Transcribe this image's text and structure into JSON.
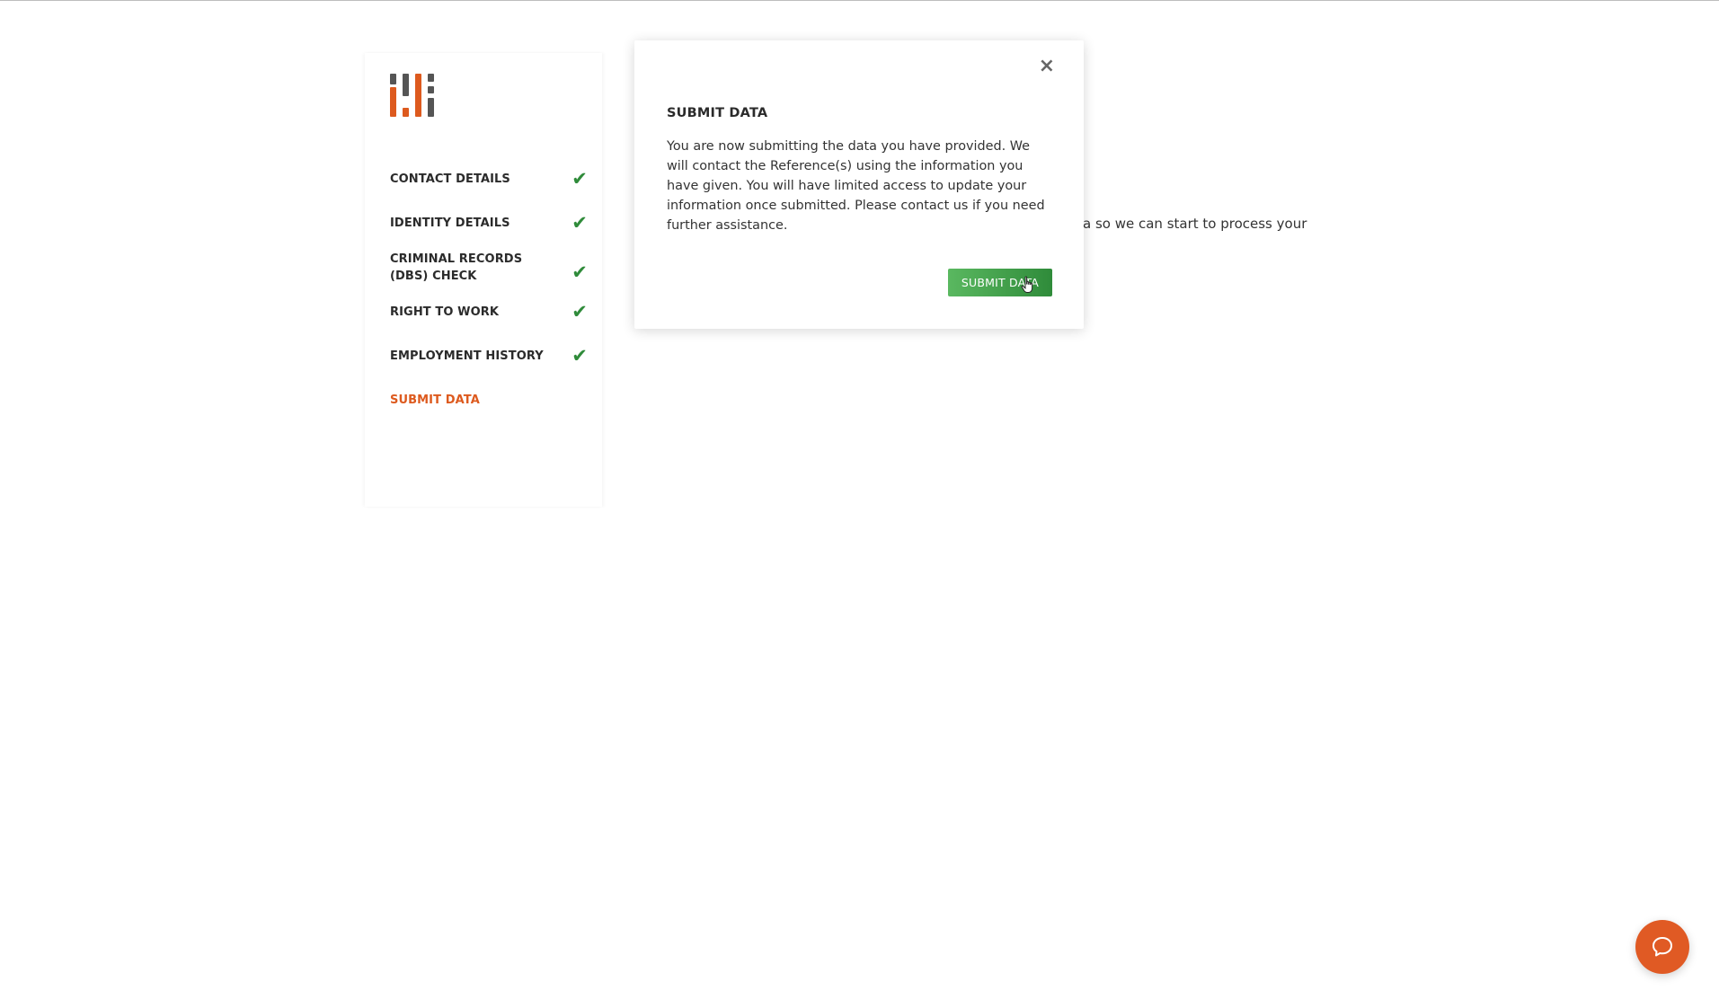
{
  "sidebar": {
    "logo": {
      "icon": "bars-logo-icon",
      "colors": {
        "orange": "#dd5a1e",
        "grey": "#555555"
      }
    },
    "items": [
      {
        "label": "CONTACT DETAILS",
        "done": true
      },
      {
        "label": "IDENTITY DETAILS",
        "done": true
      },
      {
        "label": "CRIMINAL RECORDS (DBS) CHECK",
        "done": true
      },
      {
        "label": "RIGHT TO WORK",
        "done": true
      },
      {
        "label": "EMPLOYMENT HISTORY",
        "done": true
      },
      {
        "label": "SUBMIT DATA",
        "done": false,
        "active": true
      }
    ],
    "check_glyph": "✔",
    "active_color": "#dd5a1e",
    "check_color": "#2f8b3a"
  },
  "background": {
    "partial_text": "a so we can start to process your"
  },
  "modal": {
    "close_glyph": "×",
    "title": "SUBMIT DATA",
    "body": "You are now submitting the data you have provided. We will contact the Reference(s) using the information you have given. You will have limited access to update your information once submitted. Please contact us if you need further assistance.",
    "submit_label": "SUBMIT DATA",
    "submit_color": "#3c9a45"
  },
  "chat": {
    "icon": "chat-bubble-icon",
    "color": "#e05a24"
  }
}
